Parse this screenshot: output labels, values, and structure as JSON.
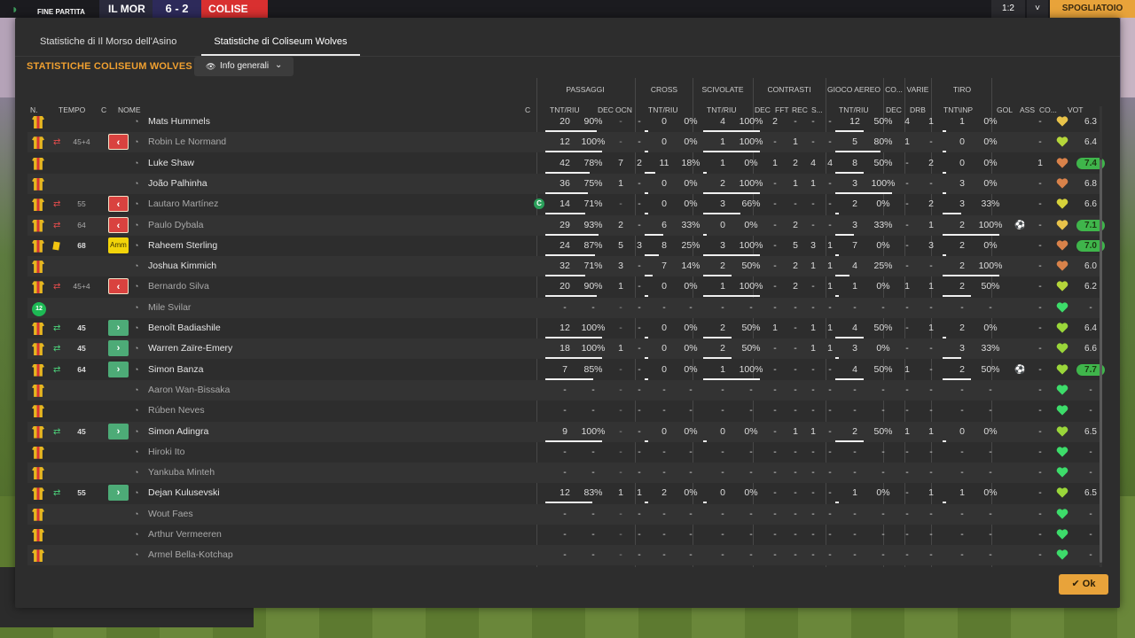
{
  "topbar": {
    "status": "FINE PARTITA",
    "home_abbr": "IL MOR",
    "score": "6 - 2",
    "away_abbr": "COLISE",
    "btn1": "1:2",
    "btn2": "˅",
    "btn3": "SPOGLIATOIO"
  },
  "tabs": [
    "Statistiche di Il Morso dell'Asino",
    "Statistiche di Coliseum Wolves"
  ],
  "title": "STATISTICHE COLISEUM WOLVES",
  "dropdown": {
    "label": "Info generali"
  },
  "groups": {
    "passaggi": "PASSAGGI",
    "cross": "CROSS",
    "scivolate": "SCIVOLATE",
    "contrasti": "CONTRASTI",
    "gioco_aereo": "GIOCO AEREO",
    "co": "CO...",
    "varie": "VARIE",
    "tiro": "TIRO"
  },
  "columns": {
    "n": "N.",
    "tempo": "TEMPO",
    "c": "C",
    "nome": "NOME",
    "c2": "C",
    "pass_tnt": "TNT/RIU",
    "pass_dec": "DEC",
    "pass_ocn": "OCN",
    "cross_tnt": "TNT/RIU",
    "sciv_tnt": "TNT/RIU",
    "con_dec": "DEC",
    "con_fft": "FFT",
    "con_rec": "REC",
    "con_s": "S...",
    "aereo_tnt": "TNT/RIU",
    "co_dec": "DEC",
    "varie_drb": "DRB",
    "tiro_tnt": "TNT\\INP",
    "gol": "GOL",
    "ass": "ASS",
    "co2": "CO...",
    "vot": "VOT"
  },
  "players": [
    {
      "num": "shirt",
      "sub": "",
      "minute": "",
      "badge": "",
      "name": "Mats Hummels",
      "dim": false,
      "cap": false,
      "pass": [
        "20",
        "90%"
      ],
      "pdec": "-",
      "pocn": "-",
      "cross": [
        "0",
        "0%"
      ],
      "sciv": [
        "4",
        "100%"
      ],
      "con": [
        "2",
        "-",
        "-",
        "-"
      ],
      "aereo": [
        "12",
        "50%"
      ],
      "codec": "4",
      "drb": "1",
      "tiro": [
        "1",
        "0%"
      ],
      "gol": "",
      "ass": "-",
      "heart": "#e8c34a",
      "rating": "6.3",
      "hi": false
    },
    {
      "num": "shirt",
      "sub": "out",
      "minute": "45+4",
      "badge": "out",
      "name": "Robin Le Normand",
      "dim": true,
      "cap": false,
      "pass": [
        "12",
        "100%"
      ],
      "pdec": "-",
      "pocn": "-",
      "cross": [
        "0",
        "0%"
      ],
      "sciv": [
        "1",
        "100%"
      ],
      "con": [
        "-",
        "1",
        "-",
        "-"
      ],
      "aereo": [
        "5",
        "80%"
      ],
      "codec": "1",
      "drb": "-",
      "tiro": [
        "0",
        "0%"
      ],
      "gol": "",
      "ass": "-",
      "heart": "#b5d63a",
      "rating": "6.4",
      "hi": false
    },
    {
      "num": "shirt",
      "sub": "",
      "minute": "",
      "badge": "",
      "name": "Luke Shaw",
      "dim": false,
      "cap": false,
      "pass": [
        "42",
        "78%"
      ],
      "pdec": "7",
      "pocn": "2",
      "cross": [
        "11",
        "18%"
      ],
      "sciv": [
        "1",
        "0%"
      ],
      "con": [
        "1",
        "2",
        "4",
        "4"
      ],
      "aereo": [
        "8",
        "50%"
      ],
      "codec": "-",
      "drb": "2",
      "tiro": [
        "0",
        "0%"
      ],
      "gol": "",
      "ass": "1",
      "heart": "#d9824a",
      "rating": "7.4",
      "hi": true
    },
    {
      "num": "shirt",
      "sub": "",
      "minute": "",
      "badge": "",
      "name": "João Palhinha",
      "dim": false,
      "cap": false,
      "pass": [
        "36",
        "75%"
      ],
      "pdec": "1",
      "pocn": "-",
      "cross": [
        "0",
        "0%"
      ],
      "sciv": [
        "2",
        "100%"
      ],
      "con": [
        "-",
        "1",
        "1",
        "-"
      ],
      "aereo": [
        "3",
        "100%"
      ],
      "codec": "-",
      "drb": "-",
      "tiro": [
        "3",
        "0%"
      ],
      "gol": "",
      "ass": "-",
      "heart": "#d9824a",
      "rating": "6.8",
      "hi": false
    },
    {
      "num": "shirt",
      "sub": "out",
      "minute": "55",
      "badge": "out",
      "name": "Lautaro Martínez",
      "dim": true,
      "cap": true,
      "pass": [
        "14",
        "71%"
      ],
      "pdec": "-",
      "pocn": "-",
      "cross": [
        "0",
        "0%"
      ],
      "sciv": [
        "3",
        "66%"
      ],
      "con": [
        "-",
        "-",
        "-",
        "-"
      ],
      "aereo": [
        "2",
        "0%"
      ],
      "codec": "-",
      "drb": "2",
      "tiro": [
        "3",
        "33%"
      ],
      "gol": "",
      "ass": "-",
      "heart": "#d6d23a",
      "rating": "6.6",
      "hi": false
    },
    {
      "num": "shirt",
      "sub": "out",
      "minute": "64",
      "badge": "out",
      "name": "Paulo Dybala",
      "dim": true,
      "cap": false,
      "pass": [
        "29",
        "93%"
      ],
      "pdec": "2",
      "pocn": "-",
      "cross": [
        "6",
        "33%"
      ],
      "sciv": [
        "0",
        "0%"
      ],
      "con": [
        "-",
        "2",
        "-",
        "-"
      ],
      "aereo": [
        "3",
        "33%"
      ],
      "codec": "-",
      "drb": "1",
      "tiro": [
        "2",
        "100%"
      ],
      "gol": "ball",
      "ass": "-",
      "heart": "#e8c34a",
      "rating": "7.1",
      "hi": true
    },
    {
      "num": "shirt",
      "sub": "card",
      "minute": "68",
      "badge": "amm",
      "name": "Raheem Sterling",
      "dim": false,
      "cap": false,
      "pass": [
        "24",
        "87%"
      ],
      "pdec": "5",
      "pocn": "3",
      "cross": [
        "8",
        "25%"
      ],
      "sciv": [
        "3",
        "100%"
      ],
      "con": [
        "-",
        "5",
        "3",
        "1"
      ],
      "aereo": [
        "7",
        "0%"
      ],
      "codec": "-",
      "drb": "3",
      "tiro": [
        "2",
        "0%"
      ],
      "gol": "",
      "ass": "-",
      "heart": "#d9824a",
      "rating": "7.0",
      "hi": true
    },
    {
      "num": "shirt",
      "sub": "",
      "minute": "",
      "badge": "",
      "name": "Joshua Kimmich",
      "dim": false,
      "cap": false,
      "pass": [
        "32",
        "71%"
      ],
      "pdec": "3",
      "pocn": "-",
      "cross": [
        "7",
        "14%"
      ],
      "sciv": [
        "2",
        "50%"
      ],
      "con": [
        "-",
        "2",
        "1",
        "1"
      ],
      "aereo": [
        "4",
        "25%"
      ],
      "codec": "-",
      "drb": "-",
      "tiro": [
        "2",
        "100%"
      ],
      "gol": "",
      "ass": "-",
      "heart": "#d9824a",
      "rating": "6.0",
      "hi": false
    },
    {
      "num": "shirt",
      "sub": "out",
      "minute": "45+4",
      "badge": "out",
      "name": "Bernardo Silva",
      "dim": true,
      "cap": false,
      "pass": [
        "20",
        "90%"
      ],
      "pdec": "1",
      "pocn": "-",
      "cross": [
        "0",
        "0%"
      ],
      "sciv": [
        "1",
        "100%"
      ],
      "con": [
        "-",
        "2",
        "-",
        "1"
      ],
      "aereo": [
        "1",
        "0%"
      ],
      "codec": "1",
      "drb": "1",
      "tiro": [
        "2",
        "50%"
      ],
      "gol": "",
      "ass": "-",
      "heart": "#b5d63a",
      "rating": "6.2",
      "hi": false
    },
    {
      "num": "gk",
      "gk_label": "12",
      "sub": "",
      "minute": "",
      "badge": "",
      "name": "Mile Svilar",
      "dim": true,
      "cap": false,
      "pass": [
        "-",
        "-"
      ],
      "pdec": "-",
      "pocn": "-",
      "cross": [
        "-",
        "-"
      ],
      "sciv": [
        "-",
        "-"
      ],
      "con": [
        "-",
        "-",
        "-",
        "-"
      ],
      "aereo": [
        "-",
        "-"
      ],
      "codec": "-",
      "drb": "-",
      "tiro": [
        "-",
        "-"
      ],
      "gol": "",
      "ass": "-",
      "heart": "#3ddc6a",
      "rating": "-",
      "hi": false
    },
    {
      "num": "shirt",
      "sub": "in",
      "minute": "45",
      "badge": "in",
      "name": "Benoît Badiashile",
      "dim": false,
      "cap": false,
      "pass": [
        "12",
        "100%"
      ],
      "pdec": "-",
      "pocn": "-",
      "cross": [
        "0",
        "0%"
      ],
      "sciv": [
        "2",
        "50%"
      ],
      "con": [
        "1",
        "-",
        "1",
        "1"
      ],
      "aereo": [
        "4",
        "50%"
      ],
      "codec": "-",
      "drb": "1",
      "tiro": [
        "2",
        "0%"
      ],
      "gol": "",
      "ass": "-",
      "heart": "#9ad63a",
      "rating": "6.4",
      "hi": false
    },
    {
      "num": "shirt",
      "sub": "in",
      "minute": "45",
      "badge": "in",
      "name": "Warren Zaïre-Emery",
      "dim": false,
      "cap": false,
      "pass": [
        "18",
        "100%"
      ],
      "pdec": "1",
      "pocn": "-",
      "cross": [
        "0",
        "0%"
      ],
      "sciv": [
        "2",
        "50%"
      ],
      "con": [
        "-",
        "-",
        "1",
        "1"
      ],
      "aereo": [
        "3",
        "0%"
      ],
      "codec": "-",
      "drb": "-",
      "tiro": [
        "3",
        "33%"
      ],
      "gol": "",
      "ass": "-",
      "heart": "#9ad63a",
      "rating": "6.6",
      "hi": false
    },
    {
      "num": "shirt",
      "sub": "in",
      "minute": "64",
      "badge": "in",
      "name": "Simon Banza",
      "dim": false,
      "cap": false,
      "pass": [
        "7",
        "85%"
      ],
      "pdec": "-",
      "pocn": "-",
      "cross": [
        "0",
        "0%"
      ],
      "sciv": [
        "1",
        "100%"
      ],
      "con": [
        "-",
        "-",
        "-",
        "-"
      ],
      "aereo": [
        "4",
        "50%"
      ],
      "codec": "1",
      "drb": "-",
      "tiro": [
        "2",
        "50%"
      ],
      "gol": "ball",
      "ass": "-",
      "heart": "#9ad63a",
      "rating": "7.7",
      "hi": true
    },
    {
      "num": "shirt",
      "sub": "",
      "minute": "",
      "badge": "",
      "name": "Aaron Wan-Bissaka",
      "dim": true,
      "cap": false,
      "pass": [
        "-",
        "-"
      ],
      "pdec": "-",
      "pocn": "-",
      "cross": [
        "-",
        "-"
      ],
      "sciv": [
        "-",
        "-"
      ],
      "con": [
        "-",
        "-",
        "-",
        "-"
      ],
      "aereo": [
        "-",
        "-"
      ],
      "codec": "-",
      "drb": "-",
      "tiro": [
        "-",
        "-"
      ],
      "gol": "",
      "ass": "-",
      "heart": "#3ddc6a",
      "rating": "-",
      "hi": false
    },
    {
      "num": "shirt",
      "sub": "",
      "minute": "",
      "badge": "",
      "name": "Rúben Neves",
      "dim": true,
      "cap": false,
      "pass": [
        "-",
        "-"
      ],
      "pdec": "-",
      "pocn": "-",
      "cross": [
        "-",
        "-"
      ],
      "sciv": [
        "-",
        "-"
      ],
      "con": [
        "-",
        "-",
        "-",
        "-"
      ],
      "aereo": [
        "-",
        "-"
      ],
      "codec": "-",
      "drb": "-",
      "tiro": [
        "-",
        "-"
      ],
      "gol": "",
      "ass": "-",
      "heart": "#3ddc6a",
      "rating": "-",
      "hi": false
    },
    {
      "num": "shirt",
      "sub": "in",
      "minute": "45",
      "badge": "in",
      "name": "Simon Adingra",
      "dim": false,
      "cap": false,
      "pass": [
        "9",
        "100%"
      ],
      "pdec": "-",
      "pocn": "-",
      "cross": [
        "0",
        "0%"
      ],
      "sciv": [
        "0",
        "0%"
      ],
      "con": [
        "-",
        "1",
        "1",
        "-"
      ],
      "aereo": [
        "2",
        "50%"
      ],
      "codec": "1",
      "drb": "1",
      "tiro": [
        "0",
        "0%"
      ],
      "gol": "",
      "ass": "-",
      "heart": "#9ad63a",
      "rating": "6.5",
      "hi": false
    },
    {
      "num": "shirt",
      "sub": "",
      "minute": "",
      "badge": "",
      "name": "Hiroki Ito",
      "dim": true,
      "cap": false,
      "pass": [
        "-",
        "-"
      ],
      "pdec": "-",
      "pocn": "-",
      "cross": [
        "-",
        "-"
      ],
      "sciv": [
        "-",
        "-"
      ],
      "con": [
        "-",
        "-",
        "-",
        "-"
      ],
      "aereo": [
        "-",
        "-"
      ],
      "codec": "-",
      "drb": "-",
      "tiro": [
        "-",
        "-"
      ],
      "gol": "",
      "ass": "-",
      "heart": "#3ddc6a",
      "rating": "-",
      "hi": false
    },
    {
      "num": "shirt",
      "sub": "",
      "minute": "",
      "badge": "",
      "name": "Yankuba Minteh",
      "dim": true,
      "cap": false,
      "pass": [
        "-",
        "-"
      ],
      "pdec": "-",
      "pocn": "-",
      "cross": [
        "-",
        "-"
      ],
      "sciv": [
        "-",
        "-"
      ],
      "con": [
        "-",
        "-",
        "-",
        "-"
      ],
      "aereo": [
        "-",
        "-"
      ],
      "codec": "-",
      "drb": "-",
      "tiro": [
        "-",
        "-"
      ],
      "gol": "",
      "ass": "-",
      "heart": "#3ddc6a",
      "rating": "-",
      "hi": false
    },
    {
      "num": "shirt",
      "sub": "in",
      "minute": "55",
      "badge": "in",
      "name": "Dejan Kulusevski",
      "dim": false,
      "cap": false,
      "pass": [
        "12",
        "83%"
      ],
      "pdec": "1",
      "pocn": "1",
      "cross": [
        "2",
        "0%"
      ],
      "sciv": [
        "0",
        "0%"
      ],
      "con": [
        "-",
        "-",
        "-",
        "-"
      ],
      "aereo": [
        "1",
        "0%"
      ],
      "codec": "-",
      "drb": "1",
      "tiro": [
        "1",
        "0%"
      ],
      "gol": "",
      "ass": "-",
      "heart": "#9ad63a",
      "rating": "6.5",
      "hi": false
    },
    {
      "num": "shirt",
      "sub": "",
      "minute": "",
      "badge": "",
      "name": "Wout Faes",
      "dim": true,
      "cap": false,
      "pass": [
        "-",
        "-"
      ],
      "pdec": "-",
      "pocn": "-",
      "cross": [
        "-",
        "-"
      ],
      "sciv": [
        "-",
        "-"
      ],
      "con": [
        "-",
        "-",
        "-",
        "-"
      ],
      "aereo": [
        "-",
        "-"
      ],
      "codec": "-",
      "drb": "-",
      "tiro": [
        "-",
        "-"
      ],
      "gol": "",
      "ass": "-",
      "heart": "#3ddc6a",
      "rating": "-",
      "hi": false
    },
    {
      "num": "shirt",
      "sub": "",
      "minute": "",
      "badge": "",
      "name": "Arthur Vermeeren",
      "dim": true,
      "cap": false,
      "pass": [
        "-",
        "-"
      ],
      "pdec": "-",
      "pocn": "-",
      "cross": [
        "-",
        "-"
      ],
      "sciv": [
        "-",
        "-"
      ],
      "con": [
        "-",
        "-",
        "-",
        "-"
      ],
      "aereo": [
        "-",
        "-"
      ],
      "codec": "-",
      "drb": "-",
      "tiro": [
        "-",
        "-"
      ],
      "gol": "",
      "ass": "-",
      "heart": "#3ddc6a",
      "rating": "-",
      "hi": false
    },
    {
      "num": "shirt",
      "sub": "",
      "minute": "",
      "badge": "",
      "name": "Armel Bella-Kotchap",
      "dim": true,
      "cap": false,
      "pass": [
        "-",
        "-"
      ],
      "pdec": "-",
      "pocn": "-",
      "cross": [
        "-",
        "-"
      ],
      "sciv": [
        "-",
        "-"
      ],
      "con": [
        "-",
        "-",
        "-",
        "-"
      ],
      "aereo": [
        "-",
        "-"
      ],
      "codec": "-",
      "drb": "-",
      "tiro": [
        "-",
        "-"
      ],
      "gol": "",
      "ass": "-",
      "heart": "#3ddc6a",
      "rating": "-",
      "hi": false
    }
  ],
  "badges": {
    "out": "‹",
    "in": "›",
    "amm": "Amm",
    "cap": "C"
  },
  "ok_label": "Ok"
}
